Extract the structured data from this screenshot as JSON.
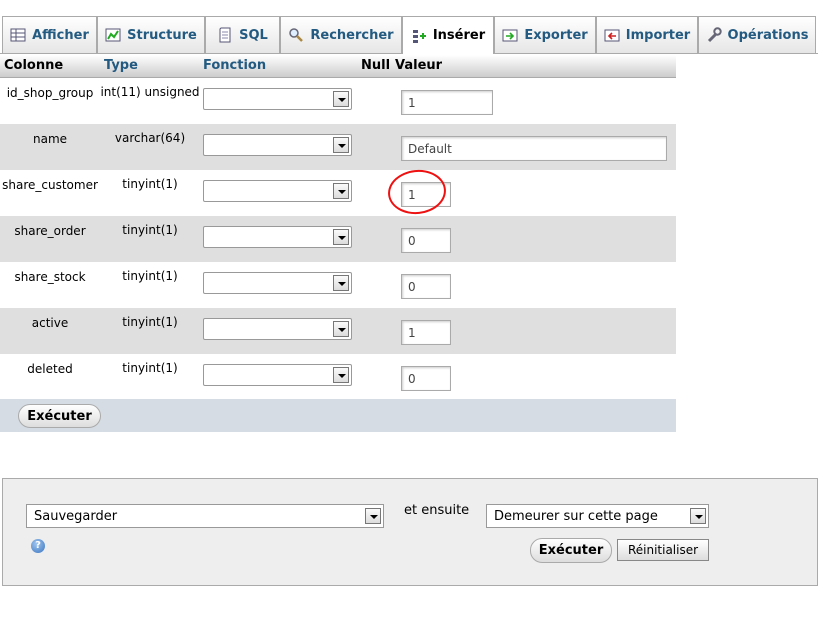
{
  "tabs": [
    {
      "label": "Afficher",
      "icon": "browse-icon",
      "active": false
    },
    {
      "label": "Structure",
      "icon": "structure-icon",
      "active": false
    },
    {
      "label": "SQL",
      "icon": "sql-icon",
      "active": false
    },
    {
      "label": "Rechercher",
      "icon": "search-icon",
      "active": false
    },
    {
      "label": "Insérer",
      "icon": "insert-icon",
      "active": true
    },
    {
      "label": "Exporter",
      "icon": "export-icon",
      "active": false
    },
    {
      "label": "Importer",
      "icon": "import-icon",
      "active": false
    },
    {
      "label": "Opérations",
      "icon": "wrench-icon",
      "active": false
    }
  ],
  "table": {
    "headers": {
      "column": "Colonne",
      "type": "Type",
      "function": "Fonction",
      "null": "Null",
      "value": "Valeur"
    },
    "rows": [
      {
        "name": "id_shop_group",
        "type": "int(11) unsigned",
        "function": "",
        "value": "1"
      },
      {
        "name": "name",
        "type": "varchar(64)",
        "function": "",
        "value": "Default"
      },
      {
        "name": "share_customer",
        "type": "tinyint(1)",
        "function": "",
        "value": "1"
      },
      {
        "name": "share_order",
        "type": "tinyint(1)",
        "function": "",
        "value": "0"
      },
      {
        "name": "share_stock",
        "type": "tinyint(1)",
        "function": "",
        "value": "0"
      },
      {
        "name": "active",
        "type": "tinyint(1)",
        "function": "",
        "value": "1"
      },
      {
        "name": "deleted",
        "type": "tinyint(1)",
        "function": "",
        "value": "0"
      }
    ],
    "execute_label": "Exécuter"
  },
  "footer": {
    "action_select": "Sauvegarder",
    "and_then_label": "et ensuite",
    "after_select": "Demeurer sur cette page",
    "execute_label": "Exécuter",
    "reset_label": "Réinitialiser",
    "help_icon": "help-icon"
  },
  "colors": {
    "tab_text": "#235a81",
    "annotation": "#e11111",
    "odd_row": "#ffffff",
    "even_row": "#dfdfdf",
    "execbar": "#d5dce3"
  }
}
